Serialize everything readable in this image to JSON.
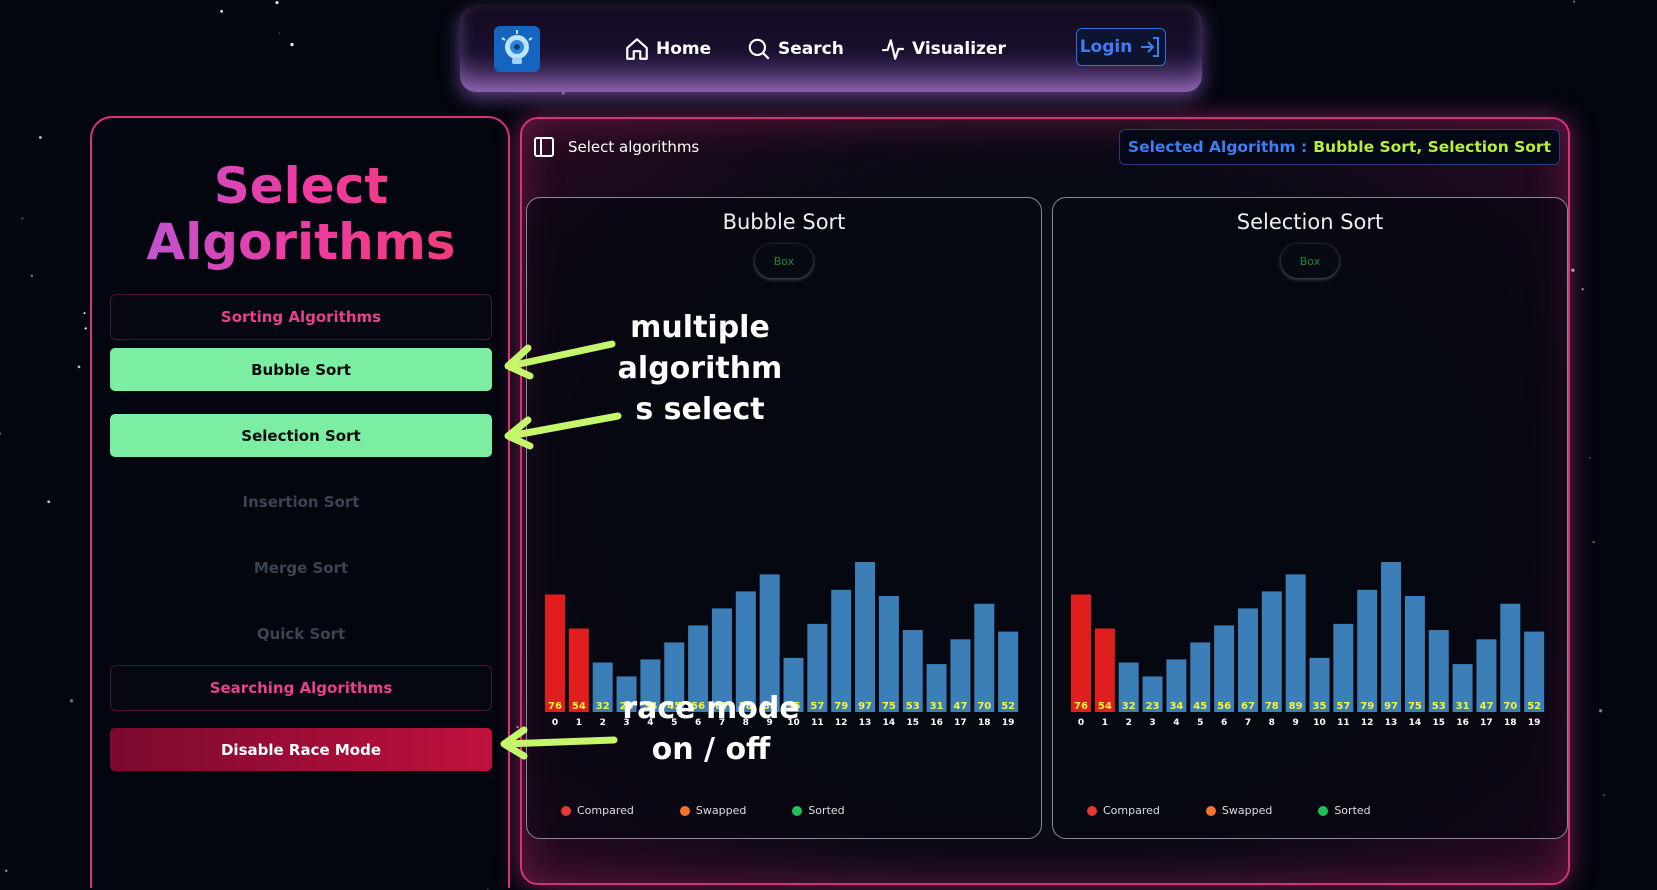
{
  "nav": {
    "items": [
      {
        "label": "Home",
        "icon": "home-icon"
      },
      {
        "label": "Search",
        "icon": "search-icon"
      },
      {
        "label": "Visualizer",
        "icon": "pulse-icon"
      }
    ],
    "login_label": "Login"
  },
  "sidebar": {
    "title_line1": "Select",
    "title_line2": "Algorithms",
    "sorting_heading": "Sorting Algorithms",
    "algorithms": [
      {
        "label": "Bubble Sort",
        "selected": true
      },
      {
        "label": "Selection Sort",
        "selected": true
      },
      {
        "label": "Insertion Sort",
        "selected": false
      },
      {
        "label": "Merge Sort",
        "selected": false
      },
      {
        "label": "Quick Sort",
        "selected": false
      }
    ],
    "searching_heading": "Searching Algorithms",
    "race_button": "Disable Race Mode"
  },
  "main": {
    "toggle_label": "Select algorithms",
    "selected_label": "Selected Algorithm :",
    "selected_value": "Bubble Sort, Selection Sort",
    "panels": [
      {
        "title": "Bubble Sort",
        "box_label": "Box"
      },
      {
        "title": "Selection Sort",
        "box_label": "Box"
      }
    ],
    "legend": [
      {
        "label": "Compared",
        "color": "#e53935"
      },
      {
        "label": "Swapped",
        "color": "#f4722b"
      },
      {
        "label": "Sorted",
        "color": "#1fbf5a"
      }
    ]
  },
  "chart_data": {
    "type": "bar",
    "categories": [
      "0",
      "1",
      "2",
      "3",
      "4",
      "5",
      "6",
      "7",
      "8",
      "9",
      "10",
      "11",
      "12",
      "13",
      "14",
      "15",
      "16",
      "17",
      "18",
      "19"
    ],
    "values": [
      76,
      54,
      32,
      23,
      34,
      45,
      56,
      67,
      78,
      89,
      35,
      57,
      79,
      97,
      75,
      53,
      31,
      47,
      70,
      52
    ],
    "compared_indices": [
      0,
      1
    ],
    "colors": {
      "default": "#3c7eb8",
      "compared": "#e01e1e",
      "value_label": "#f5f53a",
      "index_label": "#ffffff"
    }
  },
  "annotations": {
    "multi_select": [
      "multiple",
      "algorithm",
      "s select"
    ],
    "race_mode": [
      "race mode",
      "on / off"
    ],
    "arrow_color": "#c4f56a"
  }
}
